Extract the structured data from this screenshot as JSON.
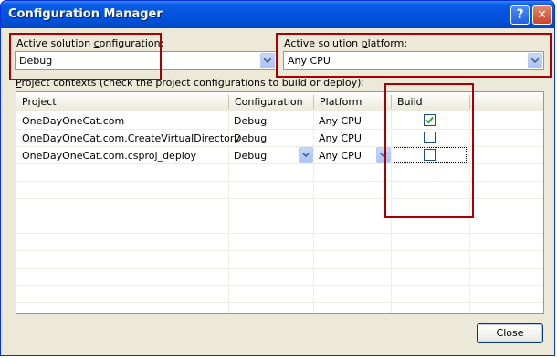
{
  "window": {
    "title": "Configuration Manager",
    "help_glyph": "?",
    "close_glyph": "✕"
  },
  "active_config": {
    "label_pre": "Active solution ",
    "label_key": "c",
    "label_post": "onfiguration:",
    "value": "Debug"
  },
  "active_platform": {
    "label_pre": "Active solution ",
    "label_key": "p",
    "label_post": "latform:",
    "value": "Any CPU"
  },
  "grid_caption": {
    "key": "P",
    "rest": "roject contexts (check the project configurations to build or deploy):"
  },
  "grid": {
    "columns": [
      "Project",
      "Configuration",
      "Platform",
      "Build"
    ],
    "rows": [
      {
        "project": "OneDayOneCat.com",
        "configuration": "Debug",
        "platform": "Any CPU",
        "build": true
      },
      {
        "project": "OneDayOneCat.com.CreateVirtualDirectory",
        "configuration": "Debug",
        "platform": "Any CPU",
        "build": false
      },
      {
        "project": "OneDayOneCat.com.csproj_deploy",
        "configuration": "Debug",
        "platform": "Any CPU",
        "build": false
      }
    ]
  },
  "buttons": {
    "close": "Close"
  },
  "colors": {
    "callout": "#a80000",
    "title_bar": "#0454e0",
    "dialog_face": "#ece9d8",
    "check": "#21a121"
  }
}
